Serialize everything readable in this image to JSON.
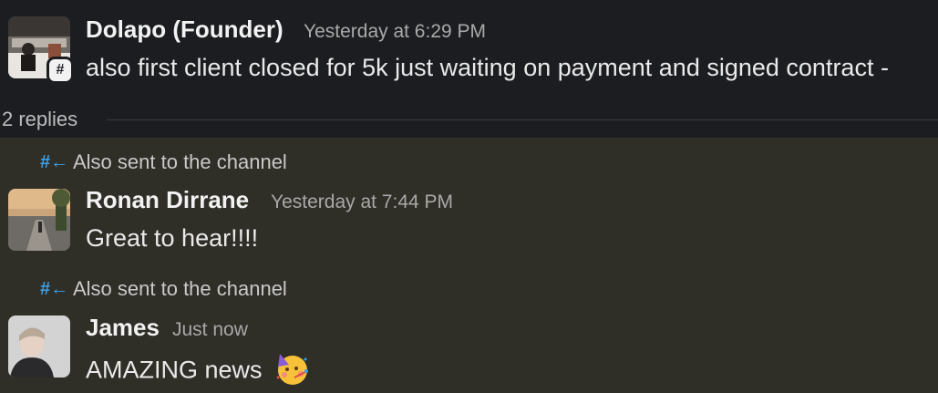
{
  "parent_message": {
    "author": "Dolapo (Founder)",
    "timestamp": "Yesterday at 6:29 PM",
    "text": "also first client closed for 5k just waiting on payment and signed contract -",
    "badge_icon": "channel-hash-icon"
  },
  "thread": {
    "replies_label": "2 replies"
  },
  "replies": [
    {
      "sent_to_channel_label": "Also sent to the channel",
      "author": "Ronan Dirrane",
      "timestamp": "Yesterday at 7:44 PM",
      "text": "Great to hear!!!!"
    },
    {
      "sent_to_channel_label": "Also sent to the channel",
      "author": "James",
      "timestamp": "Just now",
      "text": "AMAZING news",
      "emoji": "partying-face-emoji"
    }
  ],
  "colors": {
    "parent_bg": "#1c1d21",
    "thread_bg": "#2f2e27",
    "channel_icon": "#3aa0e8"
  }
}
